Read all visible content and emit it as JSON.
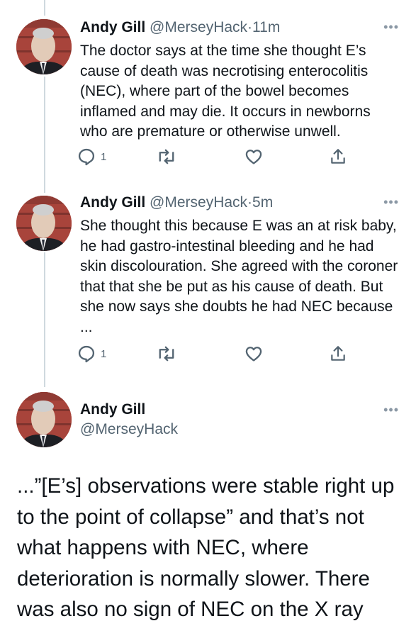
{
  "tweets": [
    {
      "name": "Andy Gill",
      "handle": "@MerseyHack",
      "separator": "·",
      "time": "11m",
      "text": "The doctor says at the time she thought E’s cause of death was necrotising enterocolitis (NEC), where part of the bowel becomes inflamed and may die. It occurs in newborns who are premature or otherwise unwell.",
      "reply_count": "1"
    },
    {
      "name": "Andy Gill",
      "handle": "@MerseyHack",
      "separator": "·",
      "time": "5m",
      "text": "She thought this because E was an at risk baby, he had gastro-intestinal bleeding and he had skin discolouration. She agreed with the coroner that that she be put as his cause of death. But she now says she doubts he had NEC because ...",
      "reply_count": "1"
    }
  ],
  "main_tweet": {
    "name": "Andy Gill",
    "handle": "@MerseyHack",
    "text": "...”[E’s] observations were stable right up to the point of collapse” and that’s not what happens with NEC, where deterioration is normally slower. There was also no sign of NEC on the X ray"
  },
  "more_glyph": "•••",
  "icons": {
    "reply": "reply-icon",
    "retweet": "retweet-icon",
    "like": "like-icon",
    "share": "share-icon",
    "more": "more-icon"
  },
  "colors": {
    "text": "#0f1419",
    "secondary": "#536471",
    "thread_line": "#cfd9de"
  }
}
